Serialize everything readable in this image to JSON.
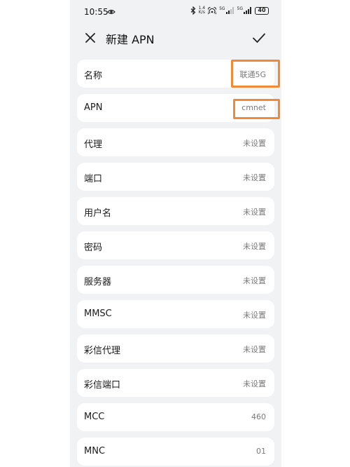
{
  "status": {
    "time": "10:55",
    "speed_top": "1.4",
    "speed_bottom": "K/s",
    "net_1": "5G",
    "net_2": "5G",
    "battery": "40"
  },
  "header": {
    "title": "新建 APN"
  },
  "rows": [
    {
      "label": "名称",
      "value": "联通5G"
    },
    {
      "label": "APN",
      "value": "cmnet"
    },
    {
      "label": "代理",
      "value": "未设置"
    },
    {
      "label": "端口",
      "value": "未设置"
    },
    {
      "label": "用户名",
      "value": "未设置"
    },
    {
      "label": "密码",
      "value": "未设置"
    },
    {
      "label": "服务器",
      "value": "未设置"
    },
    {
      "label": "MMSC",
      "value": "未设置"
    },
    {
      "label": "彩信代理",
      "value": "未设置"
    },
    {
      "label": "彩信端口",
      "value": "未设置"
    },
    {
      "label": "MCC",
      "value": "460"
    },
    {
      "label": "MNC",
      "value": "01"
    }
  ],
  "colors": {
    "highlight": "#ef8a38",
    "background": "#f1f2f4"
  }
}
